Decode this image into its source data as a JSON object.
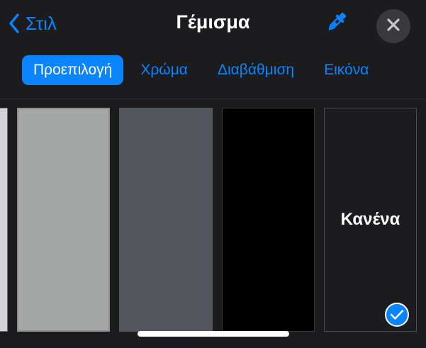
{
  "header": {
    "back_label": "Στιλ",
    "title": "Γέμισμα",
    "eyedropper_icon": "eyedropper-icon",
    "close_icon": "close-icon"
  },
  "tabs": [
    {
      "label": "Προεπιλογή",
      "active": true
    },
    {
      "label": "Χρώμα",
      "active": false
    },
    {
      "label": "Διαβάθμιση",
      "active": false
    },
    {
      "label": "Εικόνα",
      "active": false
    }
  ],
  "swatches": [
    {
      "name": "partial",
      "color": "#d1d3d4"
    },
    {
      "name": "light-gray",
      "color": "#a5a7a6"
    },
    {
      "name": "dark-gray",
      "color": "#52555c"
    },
    {
      "name": "black",
      "color": "#000000"
    },
    {
      "name": "none",
      "label": "Κανένα",
      "selected": true
    }
  ],
  "colors": {
    "accent": "#0a84ff",
    "background": "#1c1c1e",
    "close_button_bg": "#3a3a3c"
  }
}
